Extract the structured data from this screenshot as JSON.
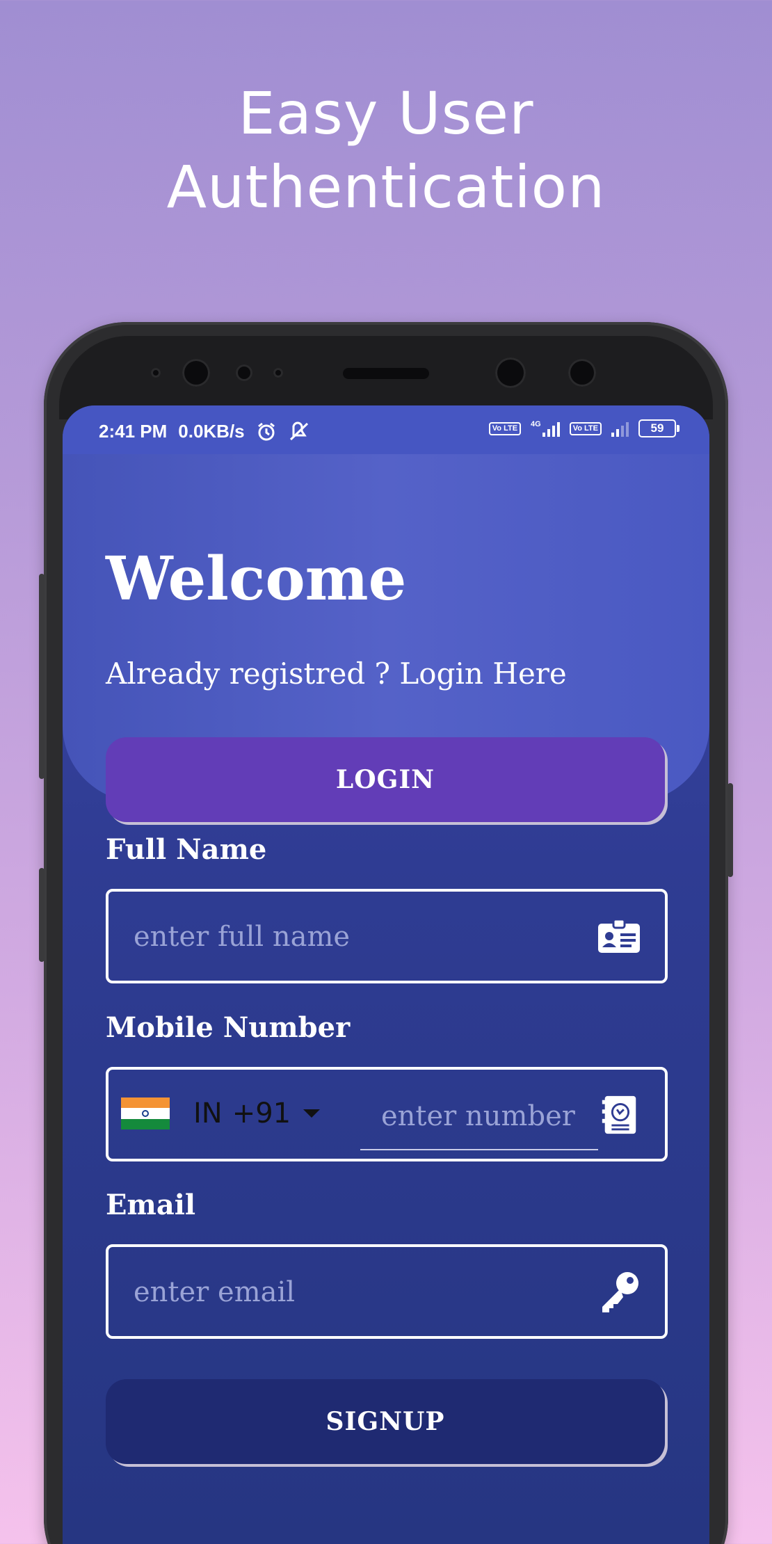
{
  "promo": {
    "headline_line1": "Easy User",
    "headline_line2": "Authentication"
  },
  "status_bar": {
    "time": "2:41 PM",
    "network_speed": "0.0KB/s",
    "icons_left": [
      "alarm-icon",
      "mute-icon"
    ],
    "volte_label": "Vo LTE",
    "network_type": "4G",
    "battery": "59"
  },
  "header": {
    "title": "Welcome",
    "subtitle": "Already registred ? Login Here",
    "login_button": "LOGIN"
  },
  "form": {
    "full_name": {
      "label": "Full Name",
      "placeholder": "enter full name",
      "icon": "id-card-icon"
    },
    "mobile": {
      "label": "Mobile Number",
      "country_code": "IN",
      "dial_code": "+91",
      "placeholder": "enter number",
      "icon": "contact-book-icon"
    },
    "email": {
      "label": "Email",
      "placeholder": "enter email",
      "icon": "key-icon"
    },
    "signup_button": "SIGNUP"
  },
  "colors": {
    "background_top": "#a08ed2",
    "background_bottom": "#f5c2ec",
    "status_bar": "#4656c2",
    "screen": "#2f3c93",
    "login_button": "#623db7",
    "signup_button": "#1f2a72"
  }
}
